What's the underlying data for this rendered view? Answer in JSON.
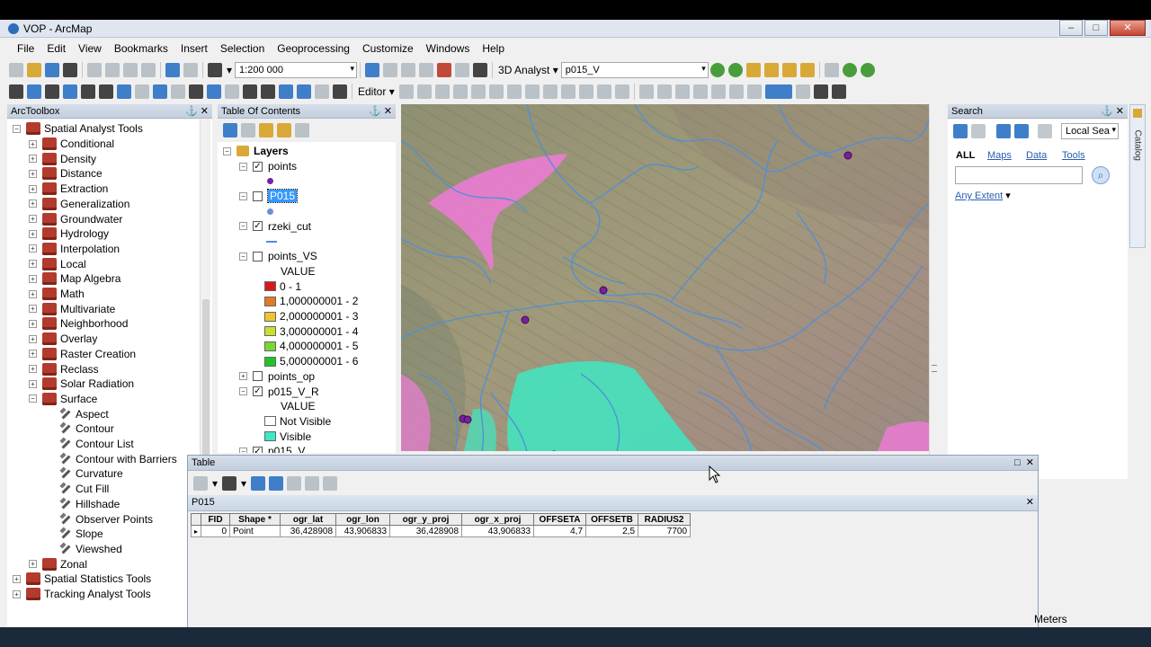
{
  "window": {
    "title": "VOP - ArcMap",
    "btn_min": "–",
    "btn_max": "□",
    "btn_close": "✕"
  },
  "menu": [
    "File",
    "Edit",
    "View",
    "Bookmarks",
    "Insert",
    "Selection",
    "Geoprocessing",
    "Customize",
    "Windows",
    "Help"
  ],
  "toolbar": {
    "scale": "1:200 000",
    "analyst_3d": "3D Analyst",
    "layer_combo": "p015_V",
    "editor": "Editor",
    "chevron": "▾"
  },
  "arctoolbox": {
    "title": "ArcToolbox",
    "root": "Spatial Analyst Tools",
    "toolsets": [
      "Conditional",
      "Density",
      "Distance",
      "Extraction",
      "Generalization",
      "Groundwater",
      "Hydrology",
      "Interpolation",
      "Local",
      "Map Algebra",
      "Math",
      "Multivariate",
      "Neighborhood",
      "Overlay",
      "Raster Creation",
      "Reclass",
      "Solar Radiation",
      "Surface"
    ],
    "surface_tools": [
      "Aspect",
      "Contour",
      "Contour List",
      "Contour with Barriers",
      "Curvature",
      "Cut Fill",
      "Hillshade",
      "Observer Points",
      "Slope",
      "Viewshed"
    ],
    "after": [
      "Zonal"
    ],
    "other_roots": [
      "Spatial Statistics Tools",
      "Tracking Analyst Tools"
    ]
  },
  "toc": {
    "title": "Table Of Contents",
    "layers_label": "Layers",
    "items": [
      {
        "name": "points",
        "checked": true
      },
      {
        "name": "P015",
        "checked": false,
        "selected": true
      },
      {
        "name": "rzeki_cut",
        "checked": true
      },
      {
        "name": "points_VS",
        "checked": false
      }
    ],
    "value_label": "VALUE",
    "vs_classes": [
      {
        "label": "0 - 1",
        "color": "#d7191c"
      },
      {
        "label": "1,000000001 - 2",
        "color": "#e07a24"
      },
      {
        "label": "2,000000001 - 3",
        "color": "#f0c330"
      },
      {
        "label": "3,000000001 - 4",
        "color": "#c8e034"
      },
      {
        "label": "4,000000001 - 5",
        "color": "#78d832"
      },
      {
        "label": "5,000000001 - 6",
        "color": "#22c22a"
      }
    ],
    "points_op": "points_op",
    "p015_v_r": "p015_V_R",
    "vr_value_label": "VALUE",
    "vr_classes": [
      {
        "label": "Not Visible",
        "color": "#ffffff"
      },
      {
        "label": "Visible",
        "color": "#3ee8c2"
      }
    ],
    "p015_v": "p015_V"
  },
  "search": {
    "title": "Search",
    "scope": "Local Sea",
    "tabs": [
      "ALL",
      "Maps",
      "Data",
      "Tools"
    ],
    "extent": "Any Extent",
    "catalog_label": "Catalog"
  },
  "table": {
    "title": "Table",
    "tab_name": "P015",
    "columns": [
      "FID",
      "Shape *",
      "ogr_lat",
      "ogr_lon",
      "ogr_y_proj",
      "ogr_x_proj",
      "OFFSETA",
      "OFFSETB",
      "RADIUS2"
    ],
    "rows": [
      [
        "0",
        "Point",
        "36,428908",
        "43,906833",
        "36,428908",
        "43,906833",
        "4,7",
        "2,5",
        "7700"
      ]
    ],
    "status_units": "Meters"
  },
  "colors": {
    "accent": "#3399ff",
    "visible": "#3ee8c2",
    "viewshed_pink": "#f07ad8",
    "river": "#4f8fd8",
    "point": "#7a1fa0"
  }
}
